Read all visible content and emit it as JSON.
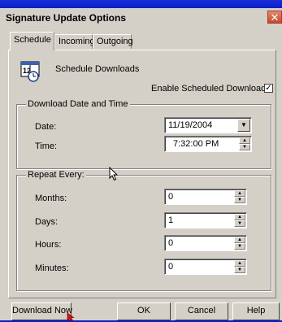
{
  "dialog": {
    "title": "Signature Update Options",
    "close_glyph": "✕"
  },
  "tabs": [
    {
      "label": "Schedule",
      "active": true
    },
    {
      "label": "Incoming",
      "active": false
    },
    {
      "label": "Outgoing",
      "active": false
    }
  ],
  "schedule": {
    "icon_text": "12",
    "heading": "Schedule Downloads",
    "enable_label": "Enable Scheduled Download",
    "enable_checked": true,
    "check_glyph": "✓"
  },
  "download_group": {
    "title": "Download Date and Time",
    "date_label": "Date:",
    "date_value": "11/19/2004",
    "time_label": "Time:",
    "time_value": "7:32:00 PM"
  },
  "repeat_group": {
    "title": "Repeat Every:",
    "months_label": "Months:",
    "months_value": "0",
    "days_label": "Days:",
    "days_value": "1",
    "hours_label": "Hours:",
    "hours_value": "0",
    "minutes_label": "Minutes:",
    "minutes_value": "0"
  },
  "buttons": {
    "download_now": "Download Now",
    "ok": "OK",
    "cancel": "Cancel",
    "help": "Help"
  },
  "colors": {
    "desktop": "#0a1fc4",
    "dialog_face": "#d4d0c8",
    "close_button": "#c14a2b"
  }
}
